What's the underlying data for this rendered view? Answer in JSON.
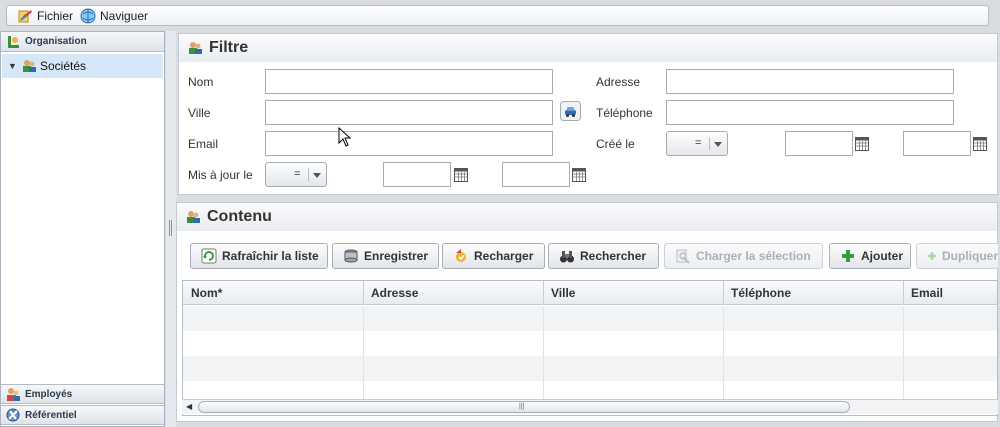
{
  "menubar": {
    "items": [
      {
        "label": "Fichier",
        "icon": "file-menu-icon"
      },
      {
        "label": "Naviguer",
        "icon": "navigate-globe-icon"
      }
    ]
  },
  "sidebar": {
    "sections": [
      {
        "label": "Organisation",
        "icon": "organisation-icon"
      },
      {
        "label": "Employés",
        "icon": "employees-icon"
      },
      {
        "label": "Référentiel",
        "icon": "referential-icon"
      }
    ],
    "tree": {
      "label": "Sociétés",
      "expanded": true,
      "icon": "companies-icon"
    }
  },
  "filter": {
    "title": "Filtre",
    "fields": {
      "nom": {
        "label": "Nom",
        "value": ""
      },
      "ville": {
        "label": "Ville",
        "value": ""
      },
      "email": {
        "label": "Email",
        "value": ""
      },
      "mis_a_jour": {
        "label": "Mis à jour le",
        "operator": "=",
        "from": "",
        "to": ""
      },
      "adresse": {
        "label": "Adresse",
        "value": ""
      },
      "telephone": {
        "label": "Téléphone",
        "value": ""
      },
      "cree_le": {
        "label": "Créé le",
        "operator": "=",
        "from": "",
        "to": ""
      }
    }
  },
  "content": {
    "title": "Contenu",
    "toolbar": [
      {
        "label": "Rafraîchir la liste",
        "icon": "refresh-icon",
        "enabled": true
      },
      {
        "label": "Enregistrer",
        "icon": "save-icon",
        "enabled": true
      },
      {
        "label": "Recharger",
        "icon": "reload-icon",
        "enabled": true
      },
      {
        "label": "Rechercher",
        "icon": "binoculars-icon",
        "enabled": true
      },
      {
        "label": "Charger la sélection",
        "icon": "load-selection-icon",
        "enabled": false
      },
      {
        "label": "Ajouter",
        "icon": "add-icon",
        "enabled": true
      },
      {
        "label": "Dupliquer",
        "icon": "duplicate-icon",
        "enabled": false
      }
    ],
    "columns": [
      "Nom*",
      "Adresse",
      "Ville",
      "Téléphone",
      "Email"
    ],
    "rows": []
  },
  "colors": {
    "selected_row": "#d6e8f7",
    "accent": "#2a6db5"
  }
}
